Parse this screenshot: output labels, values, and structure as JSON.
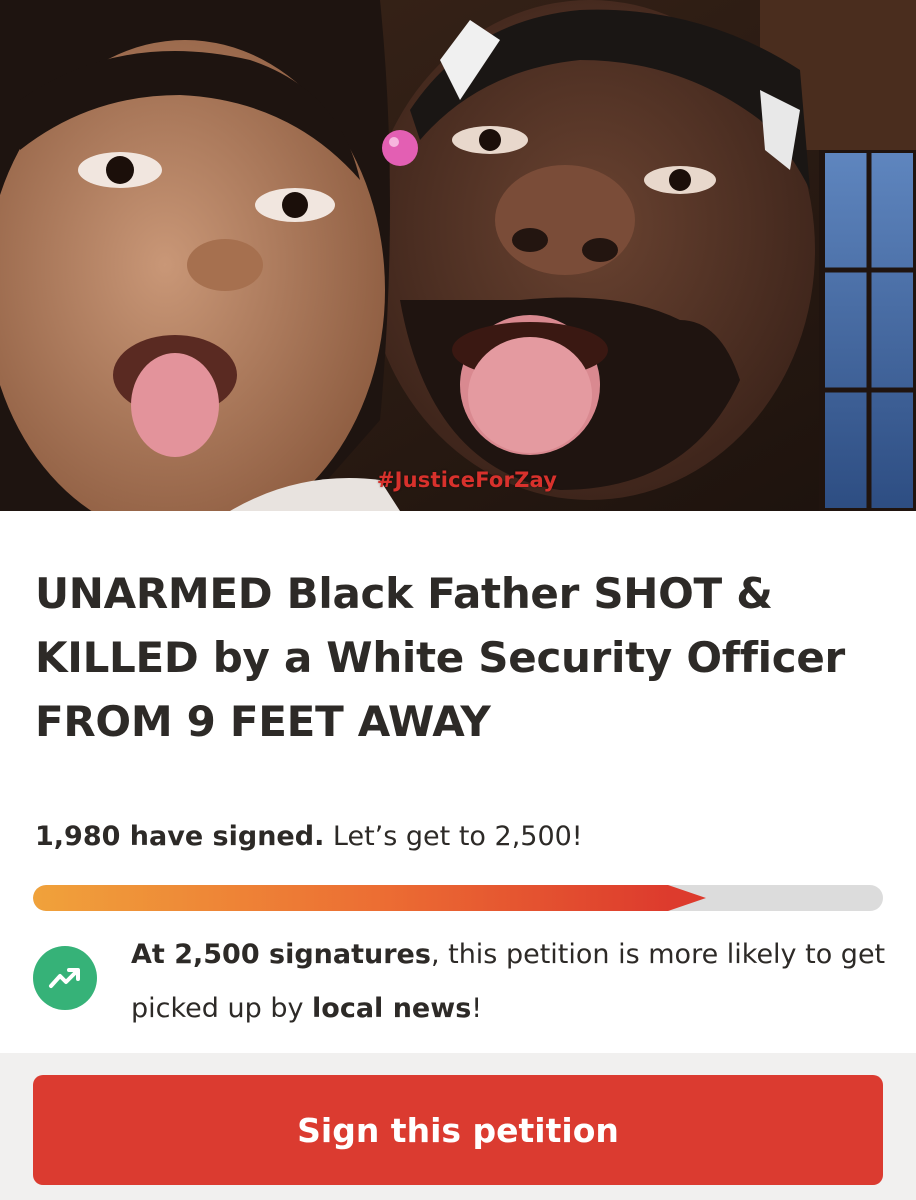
{
  "hero": {
    "hashtag": "#JusticeForZay"
  },
  "petition": {
    "title": "UNARMED Black Father SHOT & KILLED by a White Security Officer FROM 9 FEET AWAY",
    "signed_count": "1,980 have signed.",
    "signed_goal": " Let’s get to 2,500!",
    "progress_percent": 79.2
  },
  "milestone": {
    "icon": "trending-up-icon",
    "bold_1": "At 2,500 signatures",
    "text_1": ", this petition is more likely to get picked up by ",
    "bold_2": "local news",
    "text_2": "!"
  },
  "footer": {
    "sign_label": "Sign this petition"
  },
  "colors": {
    "accent": "#db3b30",
    "progress_start": "#f0a23b",
    "progress_end": "#dd3b2d",
    "trend_green": "#36b278",
    "footer_bg": "#f1f0ef"
  }
}
